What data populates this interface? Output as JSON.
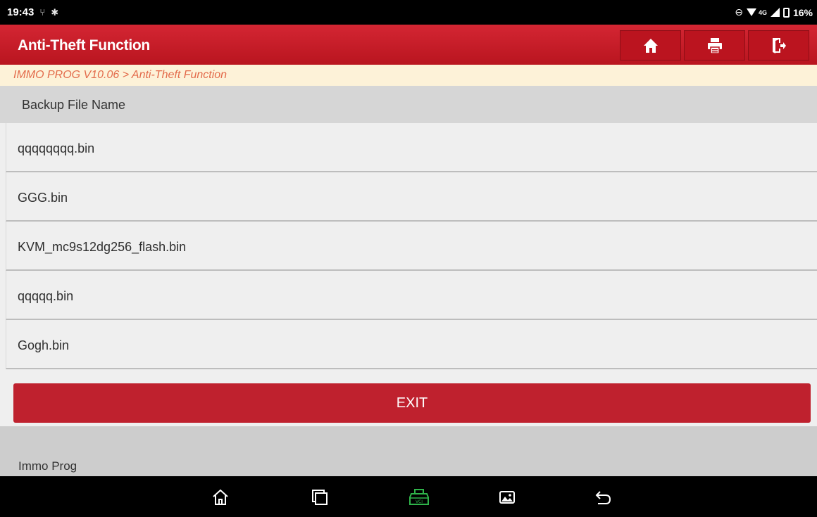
{
  "status_bar": {
    "time": "19:43",
    "network_type": "4G",
    "battery": "16%"
  },
  "header": {
    "title": "Anti-Theft Function",
    "buttons": [
      {
        "icon": "home-icon"
      },
      {
        "icon": "print-icon"
      },
      {
        "icon": "exit-icon"
      }
    ]
  },
  "breadcrumb": "IMMO PROG V10.06 > Anti-Theft Function",
  "table": {
    "column_header": "Backup File Name",
    "rows": [
      "qqqqqqqq.bin",
      "GGG.bin",
      "KVM_mc9s12dg256_flash.bin",
      "qqqqq.bin",
      "Gogh.bin"
    ]
  },
  "exit_button_label": "EXIT",
  "footer_label": "Immo Prog",
  "nav_bar": {
    "icons": [
      "home-outline-icon",
      "recent-apps-icon",
      "vci-icon",
      "gallery-icon",
      "back-icon"
    ]
  },
  "colors": {
    "brand_red": "#bf212e",
    "breadcrumb_text": "#e36b4b",
    "vci_green": "#2fb34a"
  }
}
